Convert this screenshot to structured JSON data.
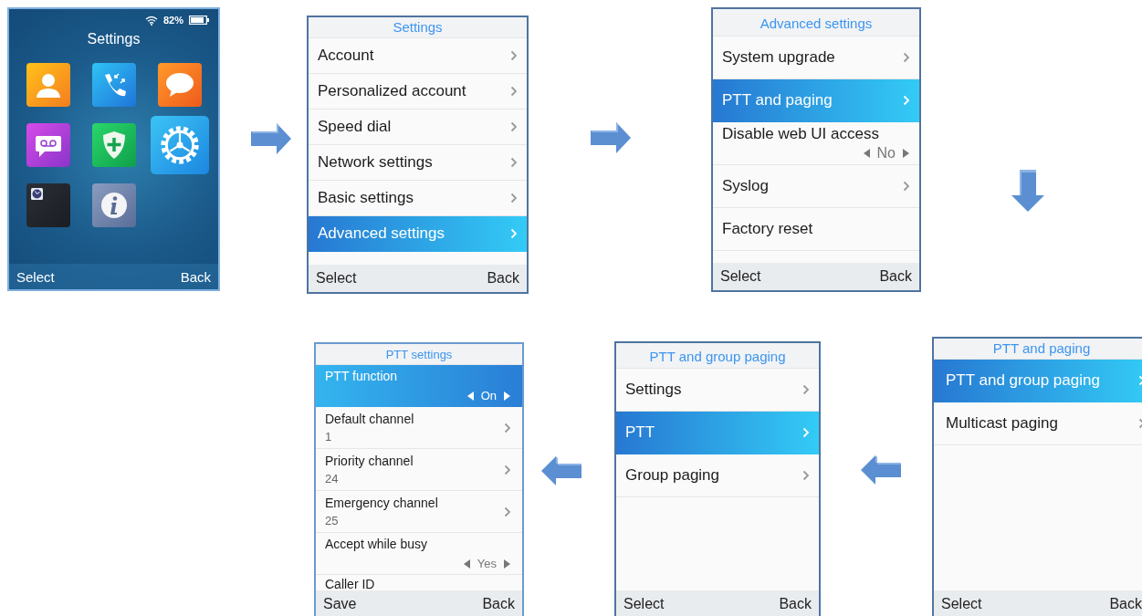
{
  "screens": [
    {
      "kind": "home",
      "status": {
        "battery": "82%"
      },
      "title": "Settings",
      "icons": [
        {
          "kind": "contacts",
          "selected": false
        },
        {
          "kind": "calls",
          "selected": false
        },
        {
          "kind": "messages",
          "selected": false
        },
        {
          "kind": "voicemail",
          "selected": false
        },
        {
          "kind": "shield",
          "selected": false
        },
        {
          "kind": "settings",
          "selected": true
        },
        {
          "kind": "clock",
          "selected": false
        },
        {
          "kind": "info",
          "selected": false
        }
      ],
      "softkeys": [
        "Select",
        "Back"
      ]
    },
    {
      "kind": "list",
      "title": "Settings",
      "rows": [
        {
          "kind": "link",
          "label": "Account",
          "selected": false
        },
        {
          "kind": "link",
          "label": "Personalized account",
          "selected": false
        },
        {
          "kind": "link",
          "label": "Speed dial",
          "selected": false
        },
        {
          "kind": "link",
          "label": "Network settings",
          "selected": false
        },
        {
          "kind": "link",
          "label": "Basic settings",
          "selected": false
        },
        {
          "kind": "link",
          "label": "Advanced settings",
          "selected": true
        }
      ],
      "softkeys": [
        "Select",
        "Back"
      ]
    },
    {
      "kind": "list",
      "title": "Advanced settings",
      "rows": [
        {
          "kind": "link",
          "label": "System upgrade",
          "selected": false
        },
        {
          "kind": "link",
          "label": "PTT and paging",
          "selected": true
        },
        {
          "kind": "toggle",
          "label": "Disable web UI access",
          "value": "No",
          "selected": false
        },
        {
          "kind": "link",
          "label": "Syslog",
          "selected": false
        },
        {
          "kind": "plain",
          "label": "Factory reset",
          "selected": false
        }
      ],
      "softkeys": [
        "Select",
        "Back"
      ]
    },
    {
      "kind": "list",
      "title": "PTT settings",
      "rows": [
        {
          "kind": "toggle",
          "label": "PTT function",
          "value": "On",
          "selected": true
        },
        {
          "kind": "sub",
          "label": "Default channel",
          "value": "1",
          "selected": false
        },
        {
          "kind": "sub",
          "label": "Priority channel",
          "value": "24",
          "selected": false
        },
        {
          "kind": "sub",
          "label": "Emergency channel",
          "value": "25",
          "selected": false
        },
        {
          "kind": "toggle",
          "label": "Accept while busy",
          "value": "Yes",
          "selected": false
        },
        {
          "kind": "plain",
          "label": "Caller ID",
          "selected": false
        }
      ],
      "softkeys": [
        "Save",
        "Back"
      ]
    },
    {
      "kind": "list",
      "title": "PTT and group paging",
      "rows": [
        {
          "kind": "link",
          "label": "Settings",
          "selected": false
        },
        {
          "kind": "link",
          "label": "PTT",
          "selected": true
        },
        {
          "kind": "link",
          "label": "Group paging",
          "selected": false
        }
      ],
      "softkeys": [
        "Select",
        "Back"
      ]
    },
    {
      "kind": "list",
      "title": "PTT and paging",
      "rows": [
        {
          "kind": "link",
          "label": "PTT and group paging",
          "selected": true
        },
        {
          "kind": "link",
          "label": "Multicast paging",
          "selected": false
        }
      ],
      "softkeys": [
        "Select",
        "Back"
      ]
    }
  ],
  "arrows": [
    {
      "kind": "right"
    },
    {
      "kind": "right"
    },
    {
      "kind": "down"
    },
    {
      "kind": "left"
    },
    {
      "kind": "left"
    }
  ]
}
